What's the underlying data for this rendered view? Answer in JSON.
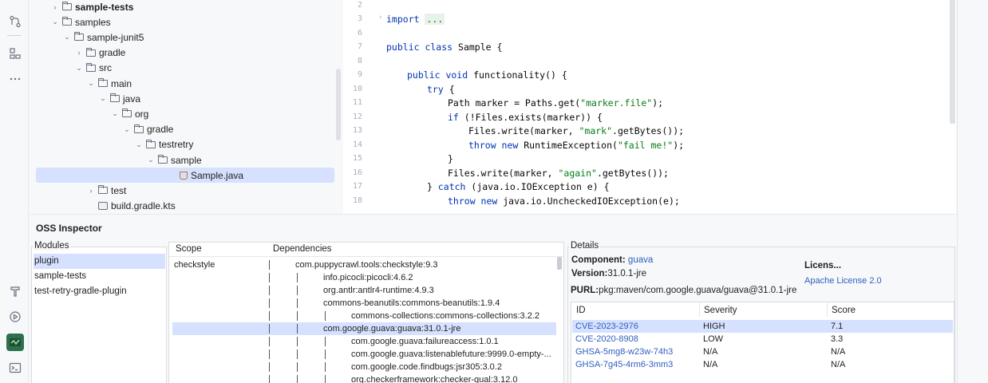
{
  "tree": {
    "items": [
      {
        "label": "sample-tests",
        "chev": "›",
        "indent": 0,
        "bold": true
      },
      {
        "label": "samples",
        "chev": "⌄",
        "indent": 0,
        "bold": false
      },
      {
        "label": "sample-junit5",
        "chev": "⌄",
        "indent": 1,
        "bold": false
      },
      {
        "label": "gradle",
        "chev": "›",
        "indent": 2,
        "bold": false
      },
      {
        "label": "src",
        "chev": "⌄",
        "indent": 2,
        "bold": false
      },
      {
        "label": "main",
        "chev": "⌄",
        "indent": 3,
        "bold": false
      },
      {
        "label": "java",
        "chev": "⌄",
        "indent": 4,
        "bold": false
      },
      {
        "label": "org",
        "chev": "⌄",
        "indent": 5,
        "bold": false
      },
      {
        "label": "gradle",
        "chev": "⌄",
        "indent": 6,
        "bold": false
      },
      {
        "label": "testretry",
        "chev": "⌄",
        "indent": 7,
        "bold": false
      },
      {
        "label": "sample",
        "chev": "⌄",
        "indent": 8,
        "bold": false
      },
      {
        "label": "Sample.java",
        "chev": "",
        "indent": 9,
        "bold": false
      },
      {
        "label": "test",
        "chev": "›",
        "indent": 3,
        "bold": false
      },
      {
        "label": "build.gradle.kts",
        "chev": "",
        "indent": 3,
        "bold": false
      }
    ]
  },
  "editor": {
    "line_numbers": [
      "2",
      "3",
      "6",
      "7",
      "8",
      "9",
      "10",
      "11",
      "12",
      "13",
      "14",
      "15",
      "16",
      "17",
      "18"
    ],
    "import_kw": "import",
    "import_fold": "...",
    "class_decl_kw": "public class",
    "class_decl_rest": " Sample {",
    "method_kw": "public void",
    "method_rest": " functionality() {",
    "try_kw": "try",
    "try_rest": " {",
    "l11_a": "Path marker = Paths.get(",
    "l11_str": "\"marker.file\"",
    "l11_b": ");",
    "l12_kw": "if",
    "l12_rest": " (!Files.exists(marker)) {",
    "l13_a": "Files.write(marker, ",
    "l13_str": "\"mark\"",
    "l13_b": ".getBytes());",
    "l14_kw": "throw new",
    "l14_a": " RuntimeException(",
    "l14_str": "\"fail me!\"",
    "l14_b": ");",
    "l15": "}",
    "l16_a": "Files.write(marker, ",
    "l16_str": "\"again\"",
    "l16_b": ".getBytes());",
    "l17_a": "} ",
    "l17_kw": "catch",
    "l17_b": " (java.io.IOException e) {",
    "l18_kw": "throw new",
    "l18_b": " java.io.UncheckedIOException(e);"
  },
  "oss": {
    "title": "OSS Inspector",
    "modules_label": "Modules",
    "modules": [
      "plugin",
      "sample-tests",
      "test-retry-gradle-plugin"
    ],
    "scope_header": "Scope",
    "deps_header": "Dependencies",
    "scope_value": "checkstyle",
    "dependencies": [
      {
        "name": "com.puppycrawl.tools:checkstyle:9.3",
        "depth": 0
      },
      {
        "name": "info.picocli:picocli:4.6.2",
        "depth": 1
      },
      {
        "name": "org.antlr:antlr4-runtime:4.9.3",
        "depth": 1
      },
      {
        "name": "commons-beanutils:commons-beanutils:1.9.4",
        "depth": 1
      },
      {
        "name": "commons-collections:commons-collections:3.2.2",
        "depth": 2
      },
      {
        "name": "com.google.guava:guava:31.0.1-jre",
        "depth": 1
      },
      {
        "name": "com.google.guava:failureaccess:1.0.1",
        "depth": 2
      },
      {
        "name": "com.google.guava:listenablefuture:9999.0-empty-...",
        "depth": 2
      },
      {
        "name": "com.google.code.findbugs:jsr305:3.0.2",
        "depth": 2
      },
      {
        "name": "org.checkerframework:checker-qual:3.12.0",
        "depth": 2
      }
    ],
    "details": {
      "label": "Details",
      "component_label": "Component:",
      "component_value": "guava",
      "version_label": "Version:",
      "version_value": "31.0.1-jre",
      "license_label": "Licens...",
      "license_value": "Apache License 2.0",
      "purl_label": "PURL:",
      "purl_value": "pkg:maven/com.google.guava/guava@31.0.1-jre",
      "col_id": "ID",
      "col_severity": "Severity",
      "col_score": "Score",
      "vulns": [
        {
          "id": "CVE-2023-2976",
          "severity": "HIGH",
          "score": "7.1"
        },
        {
          "id": "CVE-2020-8908",
          "severity": "LOW",
          "score": "3.3"
        },
        {
          "id": "GHSA-5mg8-w23w-74h3",
          "severity": "N/A",
          "score": "N/A"
        },
        {
          "id": "GHSA-7g45-4rm6-3mm3",
          "severity": "N/A",
          "score": "N/A"
        }
      ]
    }
  },
  "toolstrip": {
    "icons": [
      "git-commit-icon",
      "structure-icon",
      "more-icon",
      "build-hammer-icon",
      "run-services-icon",
      "oss-inspector-icon",
      "terminal-icon"
    ]
  }
}
